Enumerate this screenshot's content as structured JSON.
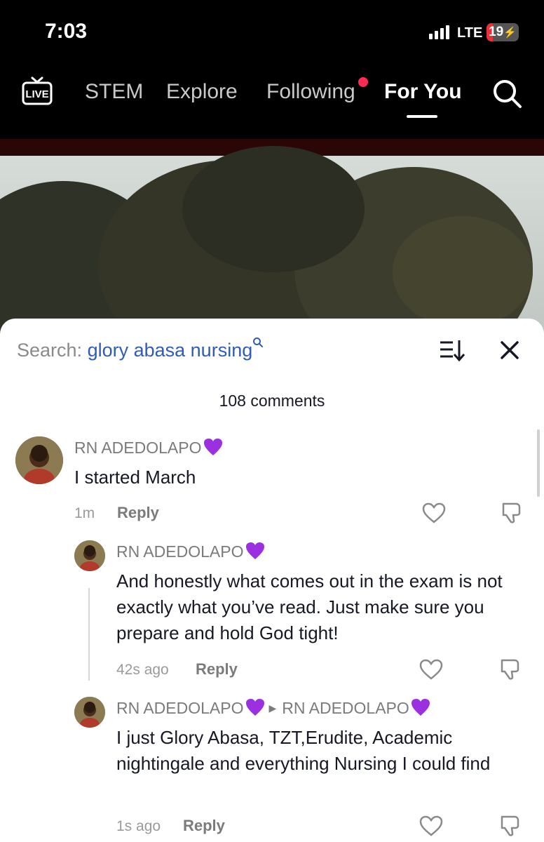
{
  "status_bar": {
    "time": "7:03",
    "network": "LTE",
    "battery": "19",
    "battery_level": 0.19
  },
  "nav": {
    "live_label": "LIVE",
    "tabs": [
      {
        "label": "STEM",
        "active": false
      },
      {
        "label": "Explore",
        "active": false
      },
      {
        "label": "Following",
        "active": false,
        "notification_dot": true
      },
      {
        "label": "For You",
        "active": true
      }
    ]
  },
  "comments_panel": {
    "search_label": "Search:",
    "search_term": "glory abasa nursing",
    "count_label": "108 comments",
    "comments": [
      {
        "username": "RN ADEDOLAPO",
        "text": "I started March",
        "time": "1m",
        "reply_label": "Reply",
        "replies": [
          {
            "username": "RN ADEDOLAPO",
            "text": "And honestly what comes out in the exam is not exactly what you’ve read. Just make sure you prepare and hold God tight!",
            "time": "42s ago",
            "reply_label": "Reply"
          },
          {
            "username": "RN ADEDOLAPO",
            "reply_to": "RN ADEDOLAPO",
            "text": "I just Glory Abasa, TZT,Erudite, Academic nightingale and everything Nursing I could find",
            "time": "1s ago",
            "reply_label": "Reply"
          }
        ]
      }
    ]
  },
  "colors": {
    "accent_red": "#fe2c55",
    "search_link": "#2f5cb4",
    "purple_heart": "#9b30e0"
  },
  "icons": [
    "live-icon",
    "search-icon",
    "sort-icon",
    "close-icon",
    "purple-heart-icon",
    "like-heart-icon",
    "dislike-icon"
  ]
}
